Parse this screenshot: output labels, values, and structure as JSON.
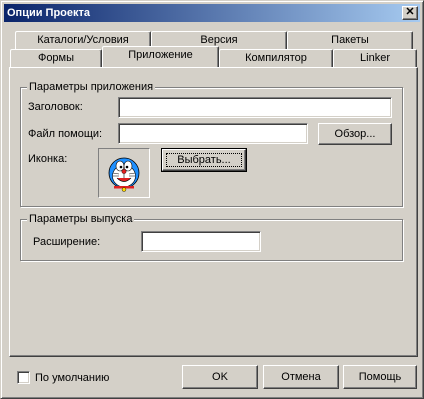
{
  "window": {
    "title": "Опции Проекта",
    "close_glyph": "✕"
  },
  "tabs": {
    "row_top": [
      {
        "label": "Каталоги/Условия"
      },
      {
        "label": "Версия"
      },
      {
        "label": "Пакеты"
      }
    ],
    "row_bottom": [
      {
        "label": "Формы"
      },
      {
        "label": "Приложение",
        "active": true
      },
      {
        "label": "Компилятор"
      },
      {
        "label": "Linker"
      }
    ]
  },
  "app_params": {
    "group_title": "Параметры приложения",
    "title_label": "Заголовок:",
    "title_value": "",
    "help_label": "Файл помощи:",
    "help_value": "",
    "browse_label": "Обзор...",
    "icon_label": "Иконка:",
    "choose_label": "Выбрать..."
  },
  "output_params": {
    "group_title": "Параметры выпуска",
    "ext_label": "Расширение:",
    "ext_value": ""
  },
  "footer": {
    "default_checkbox_label": "По умолчанию",
    "default_checked": false,
    "ok_label": "OK",
    "cancel_label": "Отмена",
    "help_label": "Помощь"
  },
  "colors": {
    "titlebar_start": "#0a246a",
    "titlebar_end": "#a6caf0",
    "face": "#d4d0c8",
    "doraemon_blue": "#1e90ff"
  }
}
